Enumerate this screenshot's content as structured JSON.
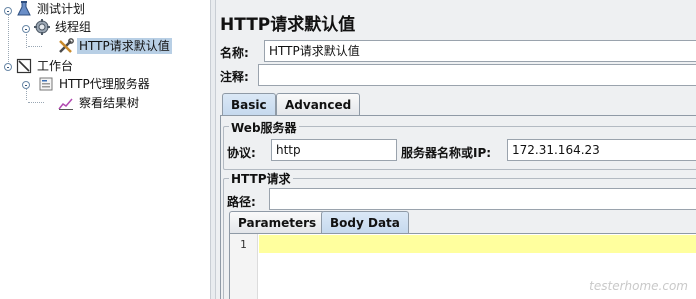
{
  "tree": {
    "items": [
      {
        "label": "测试计划",
        "icon": "test-plan-icon"
      },
      {
        "label": "线程组",
        "icon": "thread-group-gear-icon"
      },
      {
        "label": "HTTP请求默认值",
        "icon": "wrench-screwdriver-icon",
        "selected": true
      },
      {
        "label": "工作台",
        "icon": "workbench-icon"
      },
      {
        "label": "HTTP代理服务器",
        "icon": "proxy-server-icon"
      },
      {
        "label": "察看结果树",
        "icon": "results-tree-chart-icon"
      }
    ]
  },
  "panel": {
    "title": "HTTP请求默认值",
    "name_label": "名称:",
    "name_value": "HTTP请求默认值",
    "comment_label": "注释:",
    "comment_value": "",
    "tabs": [
      "Basic",
      "Advanced"
    ],
    "active_tab": "Basic",
    "web_server": {
      "group_title": "Web服务器",
      "protocol_label": "协议:",
      "protocol_value": "http",
      "server_label": "服务器名称或IP:",
      "server_value": "172.31.164.23"
    },
    "http_request": {
      "group_title": "HTTP请求",
      "path_label": "路径:",
      "path_value": ""
    },
    "sub_tabs": [
      "Parameters",
      "Body Data"
    ],
    "active_sub_tab": "Body Data",
    "editor": {
      "line_number": "1"
    }
  },
  "watermark": "testerhome.com",
  "colors": {
    "selection": "#b8cfe5",
    "active_tab": "#c6d9ee",
    "current_line": "#ffff9e",
    "panel_bg": "#eef0f2"
  }
}
